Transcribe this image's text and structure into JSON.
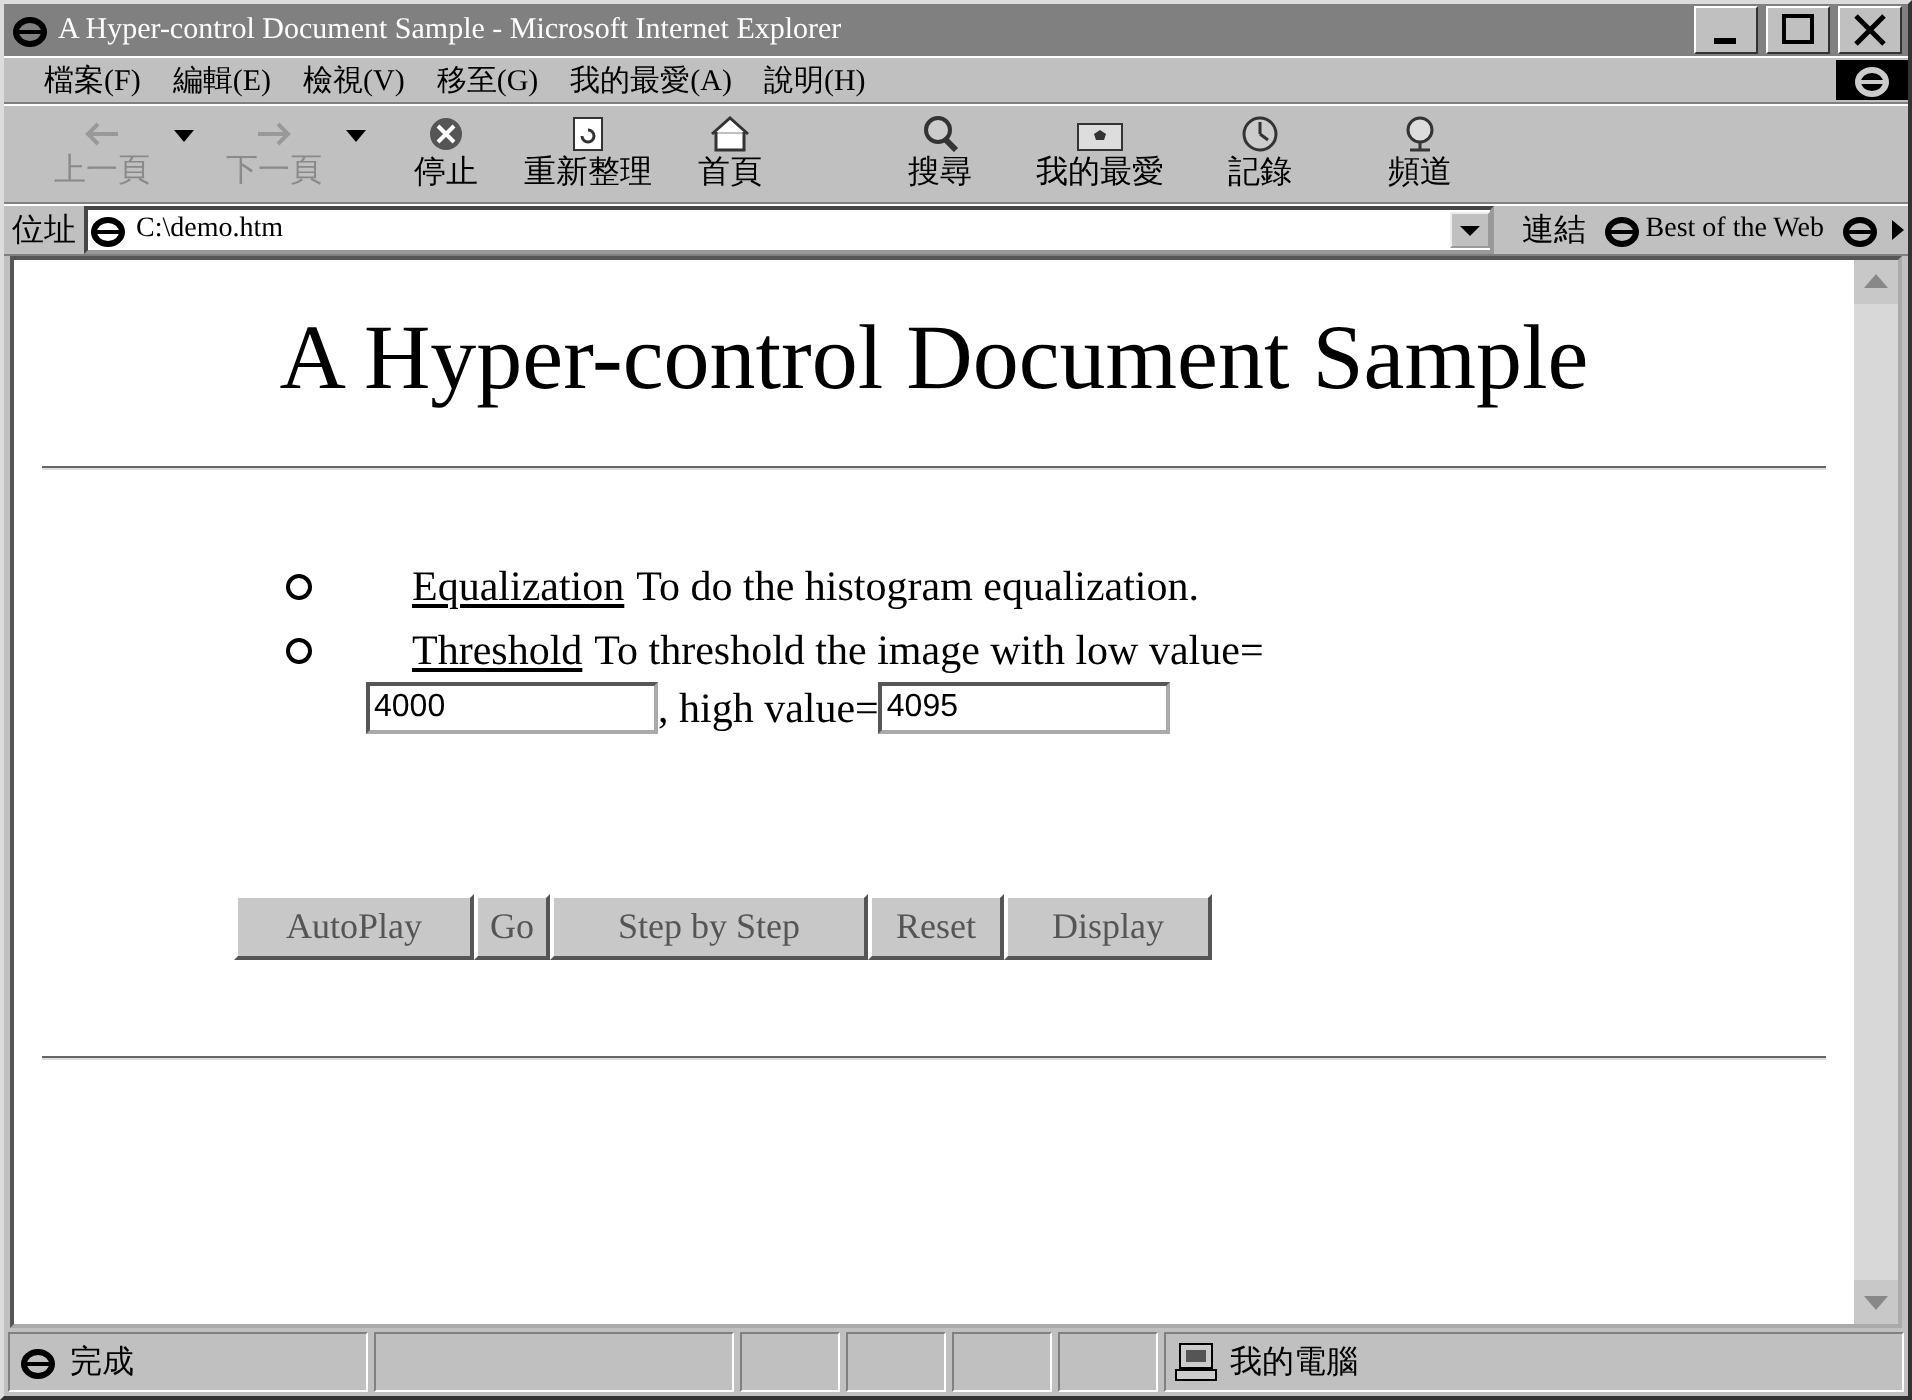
{
  "window": {
    "title": "A Hyper-control Document Sample - Microsoft Internet Explorer"
  },
  "menu": [
    "檔案(F)",
    "編輯(E)",
    "檢視(V)",
    "移至(G)",
    "我的最愛(A)",
    "說明(H)"
  ],
  "toolbar": [
    {
      "label": "上一頁",
      "kind": "back",
      "disabled": true,
      "dropdown": true
    },
    {
      "label": "下一頁",
      "kind": "forward",
      "disabled": true,
      "dropdown": true
    },
    {
      "label": "停止",
      "kind": "stop",
      "disabled": false,
      "dropdown": false
    },
    {
      "label": "重新整理",
      "kind": "refresh",
      "disabled": false,
      "dropdown": false
    },
    {
      "label": "首頁",
      "kind": "home",
      "disabled": false,
      "dropdown": false
    },
    {
      "label": "搜尋",
      "kind": "search",
      "disabled": false,
      "dropdown": false
    },
    {
      "label": "我的最愛",
      "kind": "favorites",
      "disabled": false,
      "dropdown": false
    },
    {
      "label": "記錄",
      "kind": "history",
      "disabled": false,
      "dropdown": false
    },
    {
      "label": "頻道",
      "kind": "channels",
      "disabled": false,
      "dropdown": false
    }
  ],
  "address": {
    "label": "位址",
    "value": "C:\\demo.htm",
    "links_label": "連結",
    "links": [
      "Best of the Web"
    ]
  },
  "page": {
    "heading": "A Hyper-control Document Sample",
    "items": [
      {
        "link": "Equalization",
        "text": "To do the histogram equalization."
      },
      {
        "link": "Threshold",
        "text": "To threshold the image with low value="
      }
    ],
    "low_value": "4000",
    "high_label": ", high value=",
    "high_value": "4095",
    "buttons": [
      "AutoPlay",
      "Go",
      "Step by Step",
      "Reset",
      "Display"
    ]
  },
  "status_bar": {
    "status": "完成",
    "zone": "我的電腦"
  }
}
